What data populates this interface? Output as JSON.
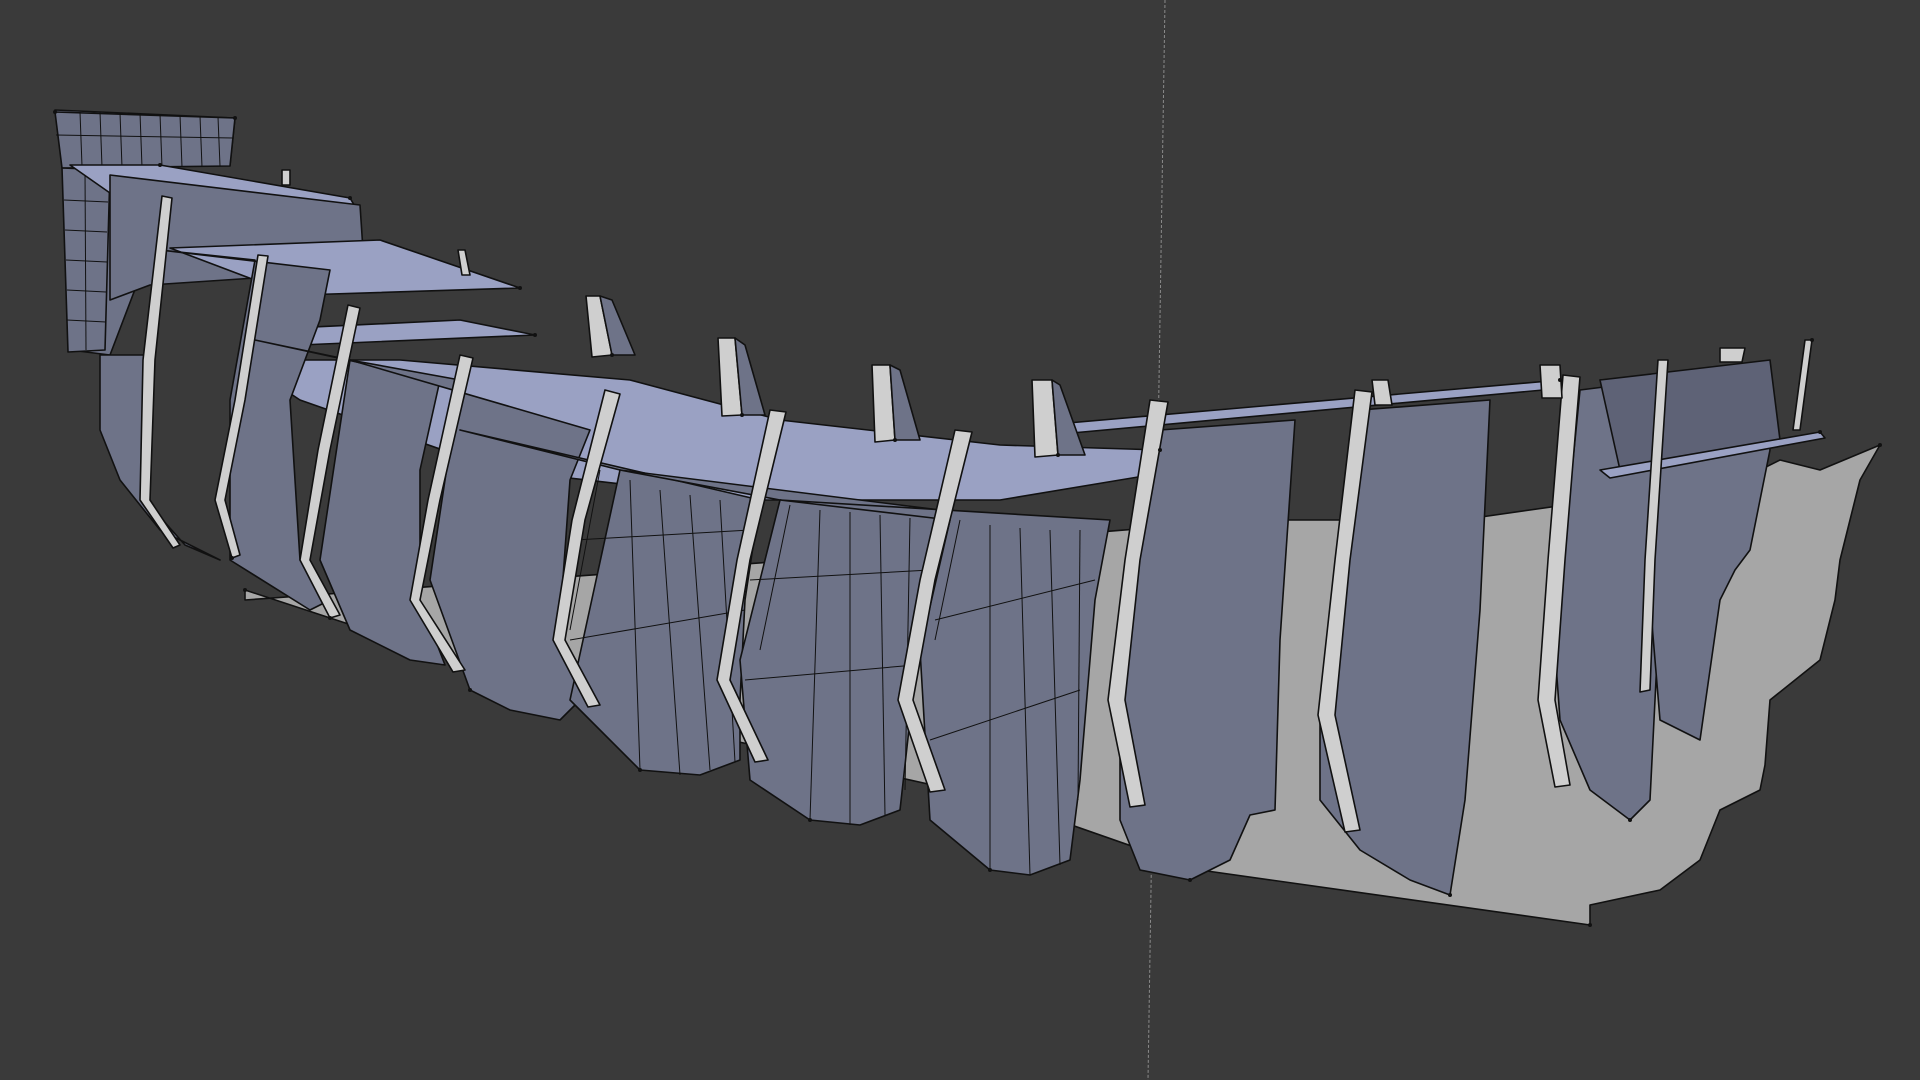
{
  "viewport": {
    "background": "#3a3a3a",
    "mode": "3d-viewport",
    "object": "ship-hull-frames"
  },
  "colors": {
    "hull_face": "#6e7388",
    "deck_face": "#9aa1c3",
    "rib_face": "#cfcfcf",
    "keel_face": "#a6a6a6",
    "edge": "#111111",
    "axis_line": "#8a8a8a"
  }
}
